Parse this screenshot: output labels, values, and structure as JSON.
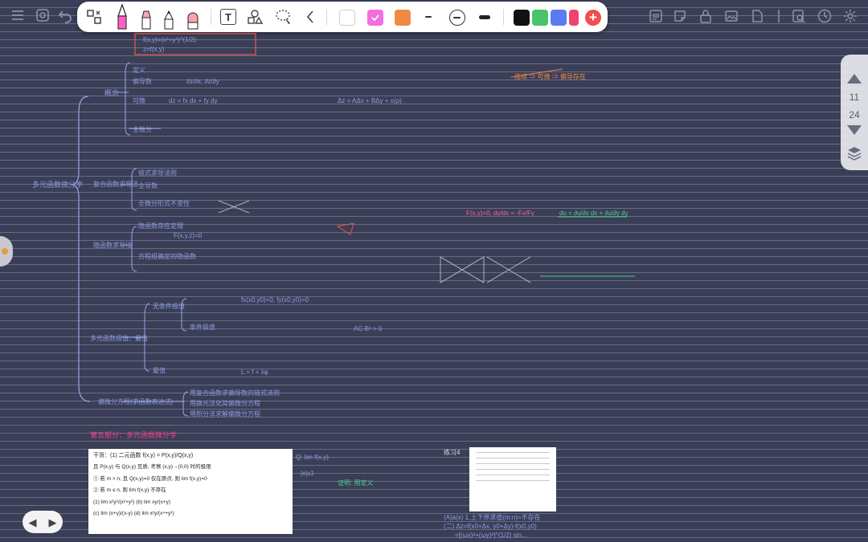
{
  "toolbar": {
    "tools": [
      {
        "name": "lasso-select-tool"
      },
      {
        "name": "pen-tool",
        "color": "#ff5fc8"
      },
      {
        "name": "highlighter-tool"
      },
      {
        "name": "pencil-tool"
      },
      {
        "name": "eraser-tool"
      },
      {
        "name": "text-tool",
        "glyph": "T"
      },
      {
        "name": "shapes-tool"
      },
      {
        "name": "lasso-tool"
      },
      {
        "name": "collapse-toolbar"
      }
    ],
    "colors": [
      "#ffffff",
      "#f36fe0",
      "#ef8a45"
    ],
    "palette": [
      "#111111",
      "#49c46b",
      "#5a7cf0",
      "#f0426e"
    ],
    "add_color_glyph": "+"
  },
  "pager": {
    "current": "11",
    "total": "24"
  },
  "nav": {
    "prev": "◀",
    "next": "▶"
  },
  "notes": {
    "topic": "多元函数微分学",
    "b1": "概念",
    "b1a": "定义",
    "b1b": "偏导数",
    "b1c": "可微",
    "b1d": "全微分",
    "b2": "复合函数求导法",
    "b2a": "链式求导法则",
    "b2b": "全导数",
    "b2c": "全微分形式不变性",
    "b3": "隐函数求导法",
    "b3a": "隐函数存在定理",
    "b3b": "方程组确定的隐函数",
    "b4": "多元函数极值、最值",
    "b4a": "无条件极值",
    "b4b": "条件极值",
    "b4c": "最值",
    "b5": "偏微分方程(求函数表达式)",
    "b5a": "用复合函数求偏导数的链式法则",
    "b5b": "用换元法化简偏微分方程",
    "b5c": "用积分法求解偏微分方程",
    "r1": "f(x,y)=(x²+y²)^(1/2)",
    "r2": "z=f(x,y)",
    "r3": "∂z/∂x, ∂z/∂y",
    "r4": "dz = fx dx + fy dy",
    "r5": "Δz = AΔx + BΔy + o(ρ)",
    "r6": "fx(x0,y0)=0, fy(x0,y0)=0",
    "r7": "AC-B² > 0",
    "r8": "L = f + λφ",
    "r9": "F(x,y,z)=0",
    "r10": "du = ∂u/∂x dx + ∂u/∂y dy",
    "r11": "连续 ⇒ 可微 ⇒ 偏导存在",
    "r12": "F(x,y)=0, dy/dx = -Fx/Fy",
    "section_title": "第五部分：多元函数微分学",
    "thumb1_title": "干货：(1) 二元函数 f(x,y) = P(x,y)/Q(x,y)",
    "thumb1_l1": "且 P(x,y) 与 Q(x,y) 互质, 考察 (x,y)→(0,0) 时的极限",
    "thumb1_l2": "① 若 m > n, 且 Q(x,y)=0 仅在原点, 则 lim f(x,y)=0",
    "thumb1_l3": "② 若 m ≤ n, 则 lim f(x,y) 不存在",
    "thumb1_l4": "(1) lim x²y²/(x²+y²)   (b) lim xy/(x+y)",
    "thumb1_l5": "(c) lim (x+y)/(x-y)   (d) lim x²y/(x⁴+y²)",
    "mid_l1": "Q: lim f(x,y)",
    "mid_l2": "|x|≤1",
    "mid_l3": "证明: 用定义",
    "practice": "练习4",
    "bottom_l1": "(A)a(x) 1.上下界求值(m:n)=不存在",
    "bottom_l2": "(二) Δz=f(x0+Δx, y0+Δy)-f(x0,y0)",
    "bottom_l3": "=[(ωx)²+(ωy)²]^(1/2) sin..."
  }
}
